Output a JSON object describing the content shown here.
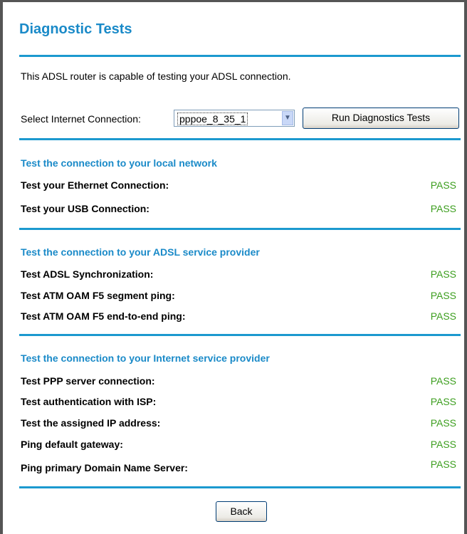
{
  "page": {
    "title": "Diagnostic Tests"
  },
  "intro_text": "This ADSL router is capable of testing your ADSL connection.",
  "connection": {
    "label": "Select Internet Connection:",
    "selected": "pppoe_8_35_1",
    "run_button": "Run Diagnostics Tests"
  },
  "sections": [
    {
      "title": "Test the connection to your local network",
      "rows": [
        {
          "label": "Test your Ethernet Connection:",
          "status": "PASS"
        },
        {
          "label": "Test your USB Connection:",
          "status": "PASS"
        }
      ]
    },
    {
      "title": "Test the connection to your ADSL service provider",
      "rows": [
        {
          "label": "Test ADSL Synchronization:",
          "status": "PASS"
        },
        {
          "label": "Test ATM OAM F5 segment ping:",
          "status": "PASS"
        },
        {
          "label": "Test ATM OAM F5 end-to-end ping:",
          "status": "PASS"
        }
      ]
    },
    {
      "title": "Test the connection to your Internet service provider",
      "rows": [
        {
          "label": "Test PPP server connection:",
          "status": "PASS"
        },
        {
          "label": "Test authentication with ISP:",
          "status": "PASS"
        },
        {
          "label": "Test the assigned IP address:",
          "status": "PASS"
        },
        {
          "label": "Ping default gateway:",
          "status": "PASS"
        },
        {
          "label": "Ping primary Domain Name Server:",
          "status": "PASS"
        }
      ]
    }
  ],
  "back_button": "Back",
  "colors": {
    "accent": "#1a8ac8",
    "pass": "#3c9e1e",
    "rule": "#1c99cf"
  },
  "icons": {
    "dropdown": "chevron-down-icon"
  }
}
